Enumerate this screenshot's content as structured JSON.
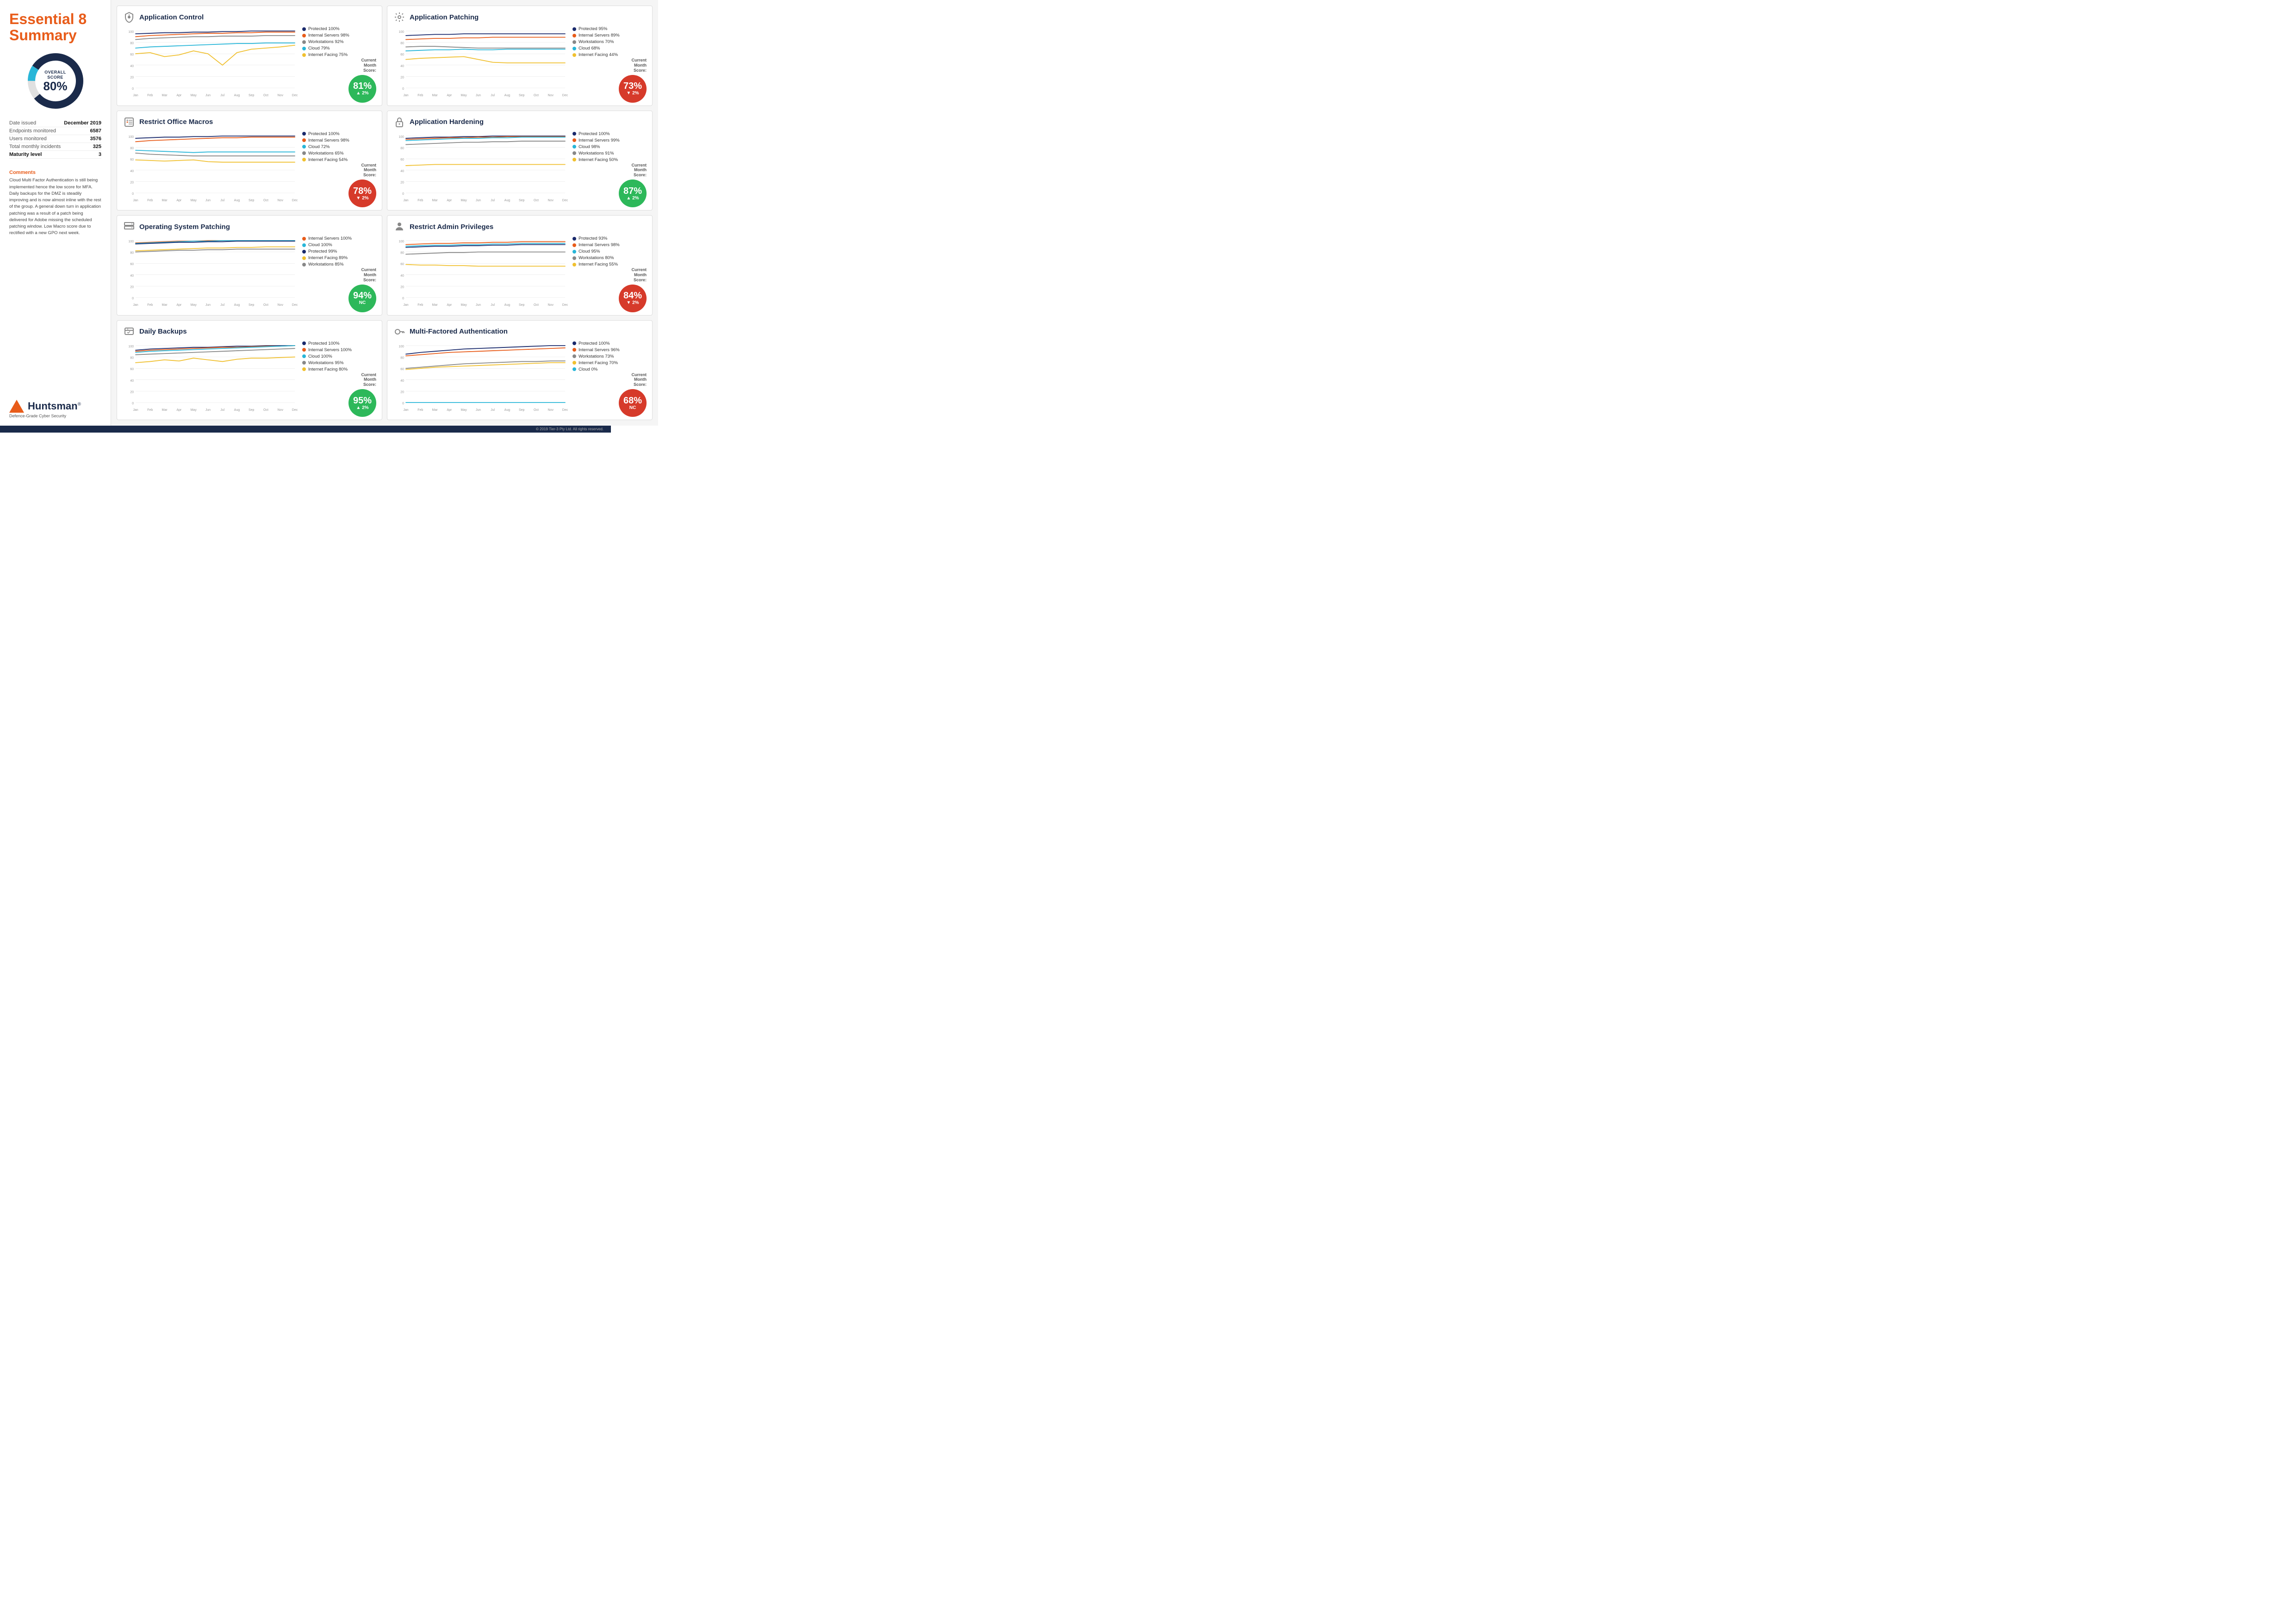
{
  "sidebar": {
    "title_line1": "Essential 8",
    "title_line2": "Summary",
    "overall_label": "OVERALL\nSCORE",
    "overall_pct": "80%",
    "donut_value": 80,
    "meta": [
      {
        "label": "Date issued",
        "value": "December 2019",
        "bold": false
      },
      {
        "label": "Endpoints monitored",
        "value": "6587",
        "bold": false
      },
      {
        "label": "Users monitored",
        "value": "3576",
        "bold": false
      },
      {
        "label": "Total monthly incidents",
        "value": "325",
        "bold": false
      },
      {
        "label": "Maturity level",
        "value": "3",
        "bold": true
      }
    ],
    "comments_title": "Comments",
    "comments_text": "Cloud Multi Factor Authentication is still being implemented hence the low score for MFA. Daily backups for the DMZ is steadily improving and is now almost inline with the rest of the group. A general down turn in application patching was a result of a patch being delivered for Adobe missing the scheduled patching window. Low Macro score due to rectified with a new GPO next week.",
    "logo_name": "Huntsman",
    "logo_tagline": "Defence-Grade Cyber Security"
  },
  "charts": [
    {
      "id": "application-control",
      "title": "Application Control",
      "icon": "shield",
      "legend": [
        {
          "label": "Protected 100%",
          "color": "#1a2a6c"
        },
        {
          "label": "Internal Servers 98%",
          "color": "#e85c1a"
        },
        {
          "label": "Workstations 92%",
          "color": "#888"
        },
        {
          "label": "Cloud 79%",
          "color": "#29b6d8"
        },
        {
          "label": "Internet Facing 75%",
          "color": "#f0c030"
        }
      ],
      "score": "81%",
      "change": "▲ 2%",
      "score_color": "green",
      "lines": [
        {
          "color": "#1a2a6c",
          "points": [
            95,
            96,
            97,
            97,
            98,
            98,
            99,
            99,
            100,
            100,
            100,
            100
          ]
        },
        {
          "color": "#e85c1a",
          "points": [
            90,
            92,
            93,
            94,
            95,
            96,
            96,
            97,
            97,
            98,
            98,
            98
          ]
        },
        {
          "color": "#888",
          "points": [
            85,
            87,
            88,
            89,
            90,
            90,
            91,
            91,
            91,
            92,
            92,
            92
          ]
        },
        {
          "color": "#29b6d8",
          "points": [
            70,
            72,
            73,
            74,
            75,
            76,
            77,
            78,
            78,
            79,
            79,
            79
          ]
        },
        {
          "color": "#f0c030",
          "points": [
            60,
            62,
            55,
            58,
            65,
            60,
            40,
            62,
            68,
            70,
            72,
            75
          ]
        }
      ]
    },
    {
      "id": "application-patching",
      "title": "Application Patching",
      "icon": "gear",
      "legend": [
        {
          "label": "Protected 95%",
          "color": "#1a2a6c"
        },
        {
          "label": "Internal Servers 89%",
          "color": "#e85c1a"
        },
        {
          "label": "Workstations 70%",
          "color": "#888"
        },
        {
          "label": "Cloud 68%",
          "color": "#29b6d8"
        },
        {
          "label": "Internet Facing 44%",
          "color": "#f0c030"
        }
      ],
      "score": "73%",
      "change": "▼ 2%",
      "score_color": "red",
      "lines": [
        {
          "color": "#1a2a6c",
          "points": [
            92,
            93,
            94,
            94,
            95,
            95,
            95,
            95,
            95,
            95,
            95,
            95
          ]
        },
        {
          "color": "#e85c1a",
          "points": [
            85,
            86,
            87,
            87,
            88,
            88,
            89,
            89,
            89,
            89,
            89,
            89
          ]
        },
        {
          "color": "#888",
          "points": [
            72,
            73,
            73,
            72,
            71,
            70,
            70,
            70,
            70,
            70,
            70,
            70
          ]
        },
        {
          "color": "#29b6d8",
          "points": [
            65,
            66,
            67,
            67,
            68,
            67,
            67,
            68,
            68,
            68,
            68,
            68
          ]
        },
        {
          "color": "#f0c030",
          "points": [
            50,
            52,
            53,
            54,
            55,
            50,
            45,
            44,
            44,
            44,
            44,
            44
          ]
        }
      ]
    },
    {
      "id": "restrict-office-macros",
      "title": "Restrict Office Macros",
      "icon": "macro",
      "legend": [
        {
          "label": "Protected 100%",
          "color": "#1a2a6c"
        },
        {
          "label": "Internal Servers 98%",
          "color": "#e85c1a"
        },
        {
          "label": "Cloud 72%",
          "color": "#29b6d8"
        },
        {
          "label": "Workstations 65%",
          "color": "#888"
        },
        {
          "label": "Internet Facing 54%",
          "color": "#f0c030"
        }
      ],
      "score": "78%",
      "change": "▼ 2%",
      "score_color": "red",
      "lines": [
        {
          "color": "#1a2a6c",
          "points": [
            96,
            97,
            98,
            98,
            99,
            99,
            100,
            100,
            100,
            100,
            100,
            100
          ]
        },
        {
          "color": "#e85c1a",
          "points": [
            90,
            92,
            93,
            94,
            95,
            96,
            97,
            97,
            98,
            98,
            98,
            98
          ]
        },
        {
          "color": "#29b6d8",
          "points": [
            75,
            74,
            73,
            72,
            71,
            72,
            72,
            72,
            72,
            72,
            72,
            72
          ]
        },
        {
          "color": "#888",
          "points": [
            70,
            68,
            67,
            66,
            65,
            65,
            65,
            65,
            65,
            65,
            65,
            65
          ]
        },
        {
          "color": "#f0c030",
          "points": [
            58,
            57,
            56,
            57,
            58,
            55,
            54,
            54,
            54,
            54,
            54,
            54
          ]
        }
      ]
    },
    {
      "id": "application-hardening",
      "title": "Application Hardening",
      "icon": "lock",
      "legend": [
        {
          "label": "Protected 100%",
          "color": "#1a2a6c"
        },
        {
          "label": "Internal Servers 99%",
          "color": "#e85c1a"
        },
        {
          "label": "Cloud 98%",
          "color": "#29b6d8"
        },
        {
          "label": "Workstations 91%",
          "color": "#888"
        },
        {
          "label": "Internet Facing 50%",
          "color": "#f0c030"
        }
      ],
      "score": "87%",
      "change": "▲ 2%",
      "score_color": "green",
      "lines": [
        {
          "color": "#1a2a6c",
          "points": [
            96,
            97,
            98,
            98,
            99,
            99,
            100,
            100,
            100,
            100,
            100,
            100
          ]
        },
        {
          "color": "#e85c1a",
          "points": [
            94,
            95,
            96,
            97,
            97,
            98,
            98,
            99,
            99,
            99,
            99,
            99
          ]
        },
        {
          "color": "#29b6d8",
          "points": [
            92,
            93,
            94,
            95,
            96,
            96,
            97,
            97,
            98,
            98,
            98,
            98
          ]
        },
        {
          "color": "#888",
          "points": [
            85,
            86,
            87,
            88,
            89,
            89,
            90,
            90,
            91,
            91,
            91,
            91
          ]
        },
        {
          "color": "#f0c030",
          "points": [
            48,
            49,
            50,
            50,
            50,
            50,
            50,
            50,
            50,
            50,
            50,
            50
          ]
        }
      ]
    },
    {
      "id": "os-patching",
      "title": "Operating System Patching",
      "icon": "server",
      "legend": [
        {
          "label": "Internal Servers 100%",
          "color": "#e85c1a"
        },
        {
          "label": "Cloud 100%",
          "color": "#29b6d8"
        },
        {
          "label": "Protected 99%",
          "color": "#1a2a6c"
        },
        {
          "label": "Internet Facing 89%",
          "color": "#f0c030"
        },
        {
          "label": "Workstations 85%",
          "color": "#888"
        }
      ],
      "score": "94%",
      "change": "NC",
      "score_color": "green",
      "lines": [
        {
          "color": "#e85c1a",
          "points": [
            96,
            97,
            98,
            99,
            99,
            100,
            100,
            100,
            100,
            100,
            100,
            100
          ]
        },
        {
          "color": "#29b6d8",
          "points": [
            95,
            96,
            97,
            98,
            99,
            99,
            100,
            100,
            100,
            100,
            100,
            100
          ]
        },
        {
          "color": "#1a2a6c",
          "points": [
            94,
            95,
            96,
            97,
            97,
            98,
            98,
            99,
            99,
            99,
            99,
            99
          ]
        },
        {
          "color": "#f0c030",
          "points": [
            82,
            83,
            84,
            85,
            86,
            87,
            87,
            88,
            88,
            89,
            89,
            89
          ]
        },
        {
          "color": "#888",
          "points": [
            80,
            81,
            82,
            83,
            83,
            84,
            84,
            85,
            85,
            85,
            85,
            85
          ]
        }
      ]
    },
    {
      "id": "restrict-admin-privileges",
      "title": "Restrict Admin Privileges",
      "icon": "person",
      "legend": [
        {
          "label": "Protected 93%",
          "color": "#1a2a6c"
        },
        {
          "label": "Internal Servers 98%",
          "color": "#e85c1a"
        },
        {
          "label": "Cloud 95%",
          "color": "#29b6d8"
        },
        {
          "label": "Workstations 80%",
          "color": "#888"
        },
        {
          "label": "Internet Facing 55%",
          "color": "#f0c030"
        }
      ],
      "score": "84%",
      "change": "▼ 2%",
      "score_color": "red",
      "lines": [
        {
          "color": "#1a2a6c",
          "points": [
            88,
            89,
            90,
            90,
            91,
            91,
            92,
            92,
            93,
            93,
            93,
            93
          ]
        },
        {
          "color": "#e85c1a",
          "points": [
            93,
            94,
            95,
            95,
            96,
            96,
            97,
            97,
            98,
            98,
            98,
            98
          ]
        },
        {
          "color": "#29b6d8",
          "points": [
            90,
            91,
            92,
            92,
            93,
            93,
            94,
            94,
            95,
            95,
            95,
            95
          ]
        },
        {
          "color": "#888",
          "points": [
            76,
            77,
            78,
            79,
            79,
            80,
            80,
            80,
            80,
            80,
            80,
            80
          ]
        },
        {
          "color": "#f0c030",
          "points": [
            58,
            57,
            57,
            56,
            56,
            55,
            55,
            55,
            55,
            55,
            55,
            55
          ]
        }
      ]
    },
    {
      "id": "daily-backups",
      "title": "Daily Backups",
      "icon": "backup",
      "legend": [
        {
          "label": "Protected 100%",
          "color": "#1a2a6c"
        },
        {
          "label": "Internal Servers 100%",
          "color": "#e85c1a"
        },
        {
          "label": "Cloud 100%",
          "color": "#29b6d8"
        },
        {
          "label": "Workstations 95%",
          "color": "#888"
        },
        {
          "label": "Internet Facing 80%",
          "color": "#f0c030"
        }
      ],
      "score": "95%",
      "change": "▲ 2%",
      "score_color": "green",
      "lines": [
        {
          "color": "#1a2a6c",
          "points": [
            92,
            94,
            95,
            96,
            97,
            97,
            98,
            99,
            99,
            100,
            100,
            100
          ]
        },
        {
          "color": "#e85c1a",
          "points": [
            90,
            92,
            93,
            94,
            95,
            96,
            97,
            97,
            98,
            99,
            99,
            100
          ]
        },
        {
          "color": "#29b6d8",
          "points": [
            88,
            90,
            91,
            92,
            93,
            94,
            95,
            96,
            97,
            98,
            99,
            100
          ]
        },
        {
          "color": "#888",
          "points": [
            84,
            85,
            86,
            87,
            88,
            89,
            90,
            91,
            92,
            93,
            94,
            95
          ]
        },
        {
          "color": "#f0c030",
          "points": [
            70,
            72,
            75,
            73,
            78,
            75,
            72,
            76,
            78,
            78,
            79,
            80
          ]
        }
      ]
    },
    {
      "id": "mfa",
      "title": "Multi-Factored Authentication",
      "icon": "key",
      "legend": [
        {
          "label": "Protected 100%",
          "color": "#1a2a6c"
        },
        {
          "label": "Internal Servers 96%",
          "color": "#e85c1a"
        },
        {
          "label": "Workstations 73%",
          "color": "#888"
        },
        {
          "label": "Internet Facing 70%",
          "color": "#f0c030"
        },
        {
          "label": "Cloud 0%",
          "color": "#29b6d8"
        }
      ],
      "score": "68%",
      "change": "NC",
      "score_color": "red",
      "lines": [
        {
          "color": "#1a2a6c",
          "points": [
            85,
            88,
            90,
            92,
            94,
            95,
            96,
            97,
            98,
            99,
            100,
            100
          ]
        },
        {
          "color": "#e85c1a",
          "points": [
            82,
            84,
            86,
            88,
            89,
            90,
            91,
            92,
            93,
            94,
            95,
            96
          ]
        },
        {
          "color": "#888",
          "points": [
            60,
            62,
            64,
            66,
            68,
            69,
            70,
            71,
            72,
            72,
            73,
            73
          ]
        },
        {
          "color": "#f0c030",
          "points": [
            58,
            60,
            62,
            63,
            64,
            65,
            66,
            67,
            68,
            69,
            70,
            70
          ]
        },
        {
          "color": "#29b6d8",
          "points": [
            0,
            0,
            0,
            0,
            0,
            0,
            0,
            0,
            0,
            0,
            0,
            0
          ]
        }
      ]
    }
  ],
  "months": [
    "Jan",
    "Feb",
    "Mar",
    "Apr",
    "May",
    "Jun",
    "Jul",
    "Aug",
    "Sep",
    "Oct",
    "Nov",
    "Dec"
  ],
  "footer": "© 2019 Tier-3 Pty Ltd. All rights reserved."
}
